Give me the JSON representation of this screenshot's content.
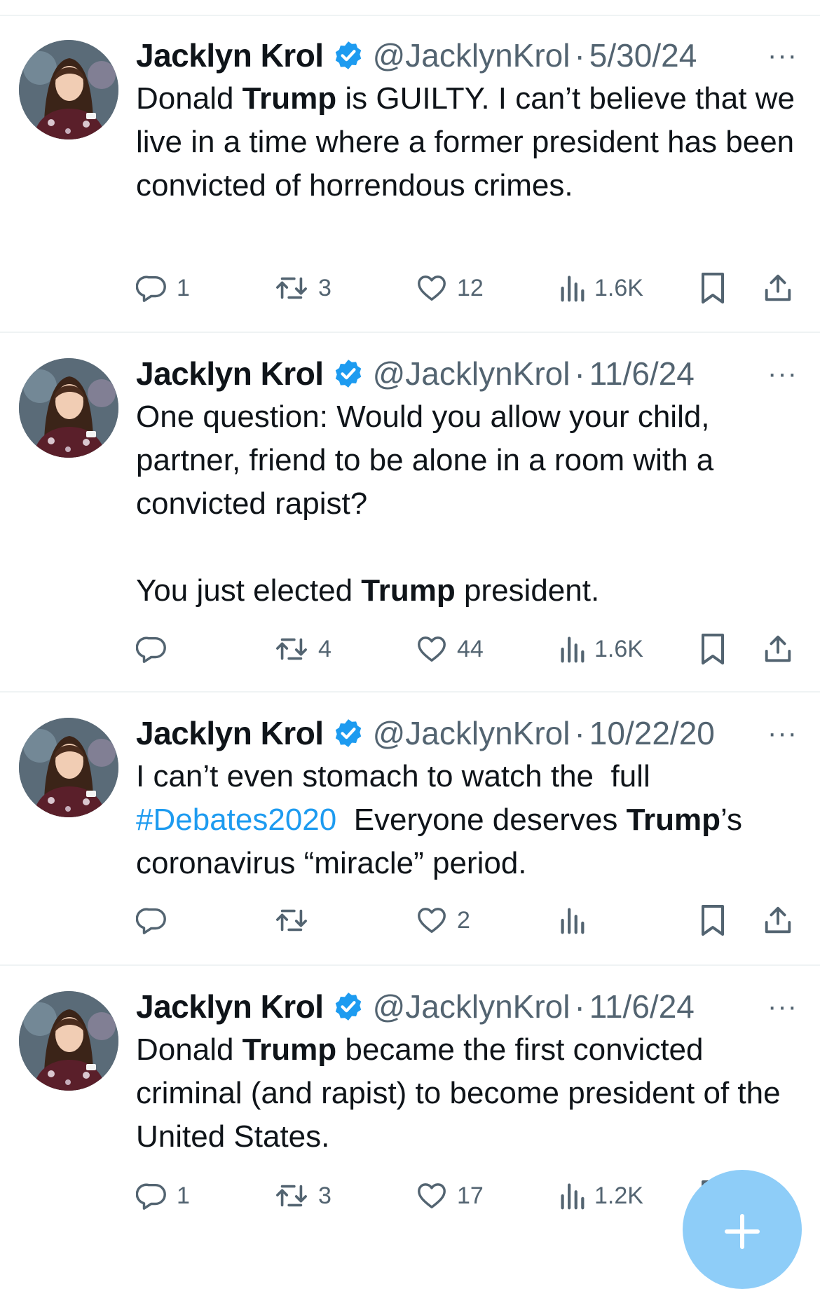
{
  "tweets": [
    {
      "name": "Jacklyn Krol",
      "handle": "@JacklynKrol",
      "date": "5/30/24",
      "more": "···",
      "text": [
        {
          "t": "Donald ",
          "s": "n"
        },
        {
          "t": "Trump",
          "s": "b"
        },
        {
          "t": " is GUILTY. I can’t believe that we live in a time where a former president has been convicted of horrendous crimes.",
          "s": "n"
        }
      ],
      "stats": {
        "replies": "1",
        "reposts": "3",
        "likes": "12",
        "views": "1.6K"
      }
    },
    {
      "name": "Jacklyn Krol",
      "handle": "@JacklynKrol",
      "date": "11/6/24",
      "more": "···",
      "text": [
        {
          "t": "One question: Would you allow your child, partner, friend to be alone in a room with a convicted rapist?\n\nYou just elected ",
          "s": "n"
        },
        {
          "t": "Trump",
          "s": "b"
        },
        {
          "t": " president.",
          "s": "n"
        }
      ],
      "stats": {
        "replies": "",
        "reposts": "4",
        "likes": "44",
        "views": "1.6K"
      }
    },
    {
      "name": "Jacklyn Krol",
      "handle": "@JacklynKrol",
      "date": "10/22/20",
      "more": "···",
      "text": [
        {
          "t": "I can’t even stomach to watch the  full ",
          "s": "n"
        },
        {
          "t": "#Debates2020",
          "s": "h"
        },
        {
          "t": "  Everyone deserves ",
          "s": "n"
        },
        {
          "t": "Trump",
          "s": "b"
        },
        {
          "t": "’s coronavirus “miracle” period.",
          "s": "n"
        }
      ],
      "stats": {
        "replies": "",
        "reposts": "",
        "likes": "2",
        "views": ""
      }
    },
    {
      "name": "Jacklyn Krol",
      "handle": "@JacklynKrol",
      "date": "11/6/24",
      "more": "···",
      "text": [
        {
          "t": "Donald ",
          "s": "n"
        },
        {
          "t": "Trump",
          "s": "b"
        },
        {
          "t": " became the first convicted criminal (and rapist) to become president of the United States.",
          "s": "n"
        }
      ],
      "stats": {
        "replies": "1",
        "reposts": "3",
        "likes": "17",
        "views": "1.2K"
      }
    }
  ],
  "colors": {
    "text": "#0f1419",
    "muted": "#536471",
    "accent": "#1d9bf0",
    "divider": "#eff3f4",
    "fab": "#8ecdf8"
  },
  "icons": {
    "verified": "verified-badge-icon",
    "reply": "reply-icon",
    "repost": "repost-icon",
    "like": "heart-icon",
    "views": "views-icon",
    "bookmark": "bookmark-icon",
    "share": "share-icon",
    "compose": "plus-icon"
  }
}
